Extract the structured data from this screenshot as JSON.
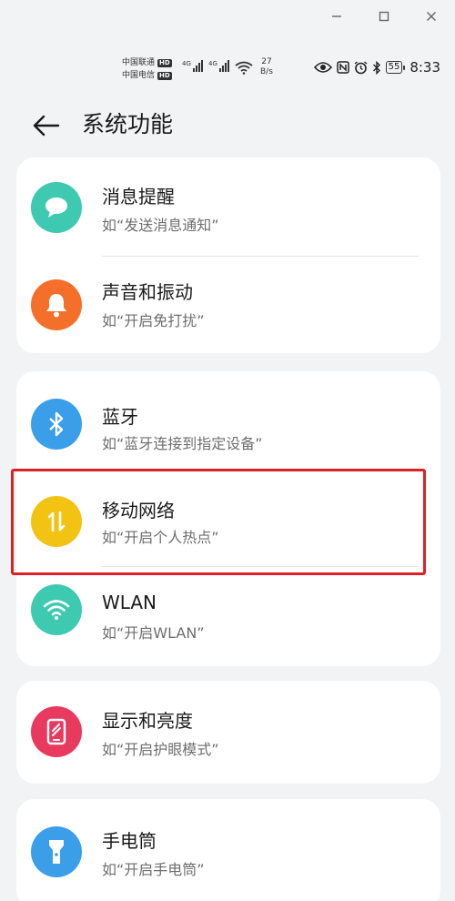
{
  "window": {
    "minimize_icon": "minimize-icon",
    "maximize_icon": "maximize-icon",
    "close_icon": "close-icon"
  },
  "status_bar": {
    "carrier1": "中国联通",
    "carrier2": "中国电信",
    "hd_label": "HD",
    "net1": "4G",
    "net2": "4G",
    "speed_value": "27",
    "speed_unit": "B/s",
    "battery": "55",
    "time": "8:33",
    "icons": [
      "wifi-icon",
      "eye-icon",
      "nfc-icon",
      "alarm-icon",
      "bluetooth-icon",
      "battery-icon"
    ]
  },
  "header": {
    "title": "系统功能",
    "back_icon": "back-arrow-icon"
  },
  "groups": [
    {
      "items": [
        {
          "title": "消息提醒",
          "subtitle": "如“发送消息通知”",
          "icon": "message-icon",
          "color": "#3ec9b1"
        },
        {
          "title": "声音和振动",
          "subtitle": "如“开启免打扰”",
          "icon": "bell-icon",
          "color": "#f36f2a"
        }
      ]
    },
    {
      "items": [
        {
          "title": "蓝牙",
          "subtitle": "如“蓝牙连接到指定设备”",
          "icon": "bluetooth-icon",
          "color": "#3a9ee9"
        },
        {
          "title": "移动网络",
          "subtitle": "如“开启个人热点”",
          "icon": "mobile-data-icon",
          "color": "#f2c313"
        },
        {
          "title": "WLAN",
          "subtitle": "如“开启WLAN”",
          "icon": "wifi-icon",
          "color": "#3ec9b1"
        }
      ]
    },
    {
      "items": [
        {
          "title": "显示和亮度",
          "subtitle": "如“开启护眼模式”",
          "icon": "display-icon",
          "color": "#e8395f"
        }
      ]
    },
    {
      "items": [
        {
          "title": "手电筒",
          "subtitle": "如“开启手电筒”",
          "icon": "flashlight-icon",
          "color": "#3a9ee9"
        }
      ]
    }
  ],
  "highlight_color": "#e02020"
}
